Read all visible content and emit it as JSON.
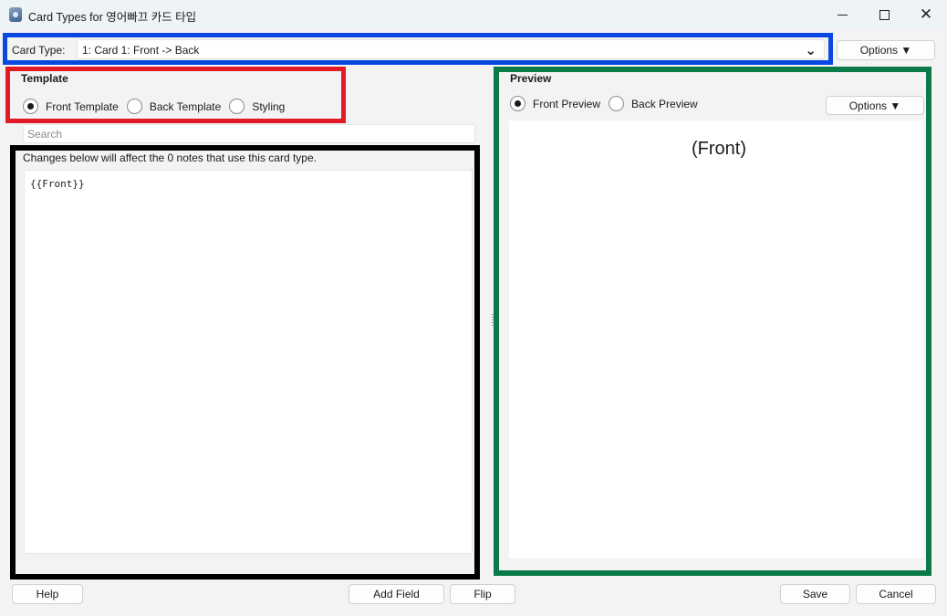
{
  "window": {
    "title": "Card Types for 영어빠끄 카드 타입",
    "icon": "anki-app-icon",
    "controls": [
      "minimize-icon",
      "maximize-icon",
      "close-icon"
    ]
  },
  "card_type": {
    "label": "Card Type:",
    "selected": "1: Card 1: Front -> Back",
    "options_button": "Options ▼"
  },
  "template": {
    "heading": "Template",
    "radios": [
      {
        "label": "Front Template",
        "checked": true
      },
      {
        "label": "Back Template",
        "checked": false
      },
      {
        "label": "Styling",
        "checked": false
      }
    ],
    "search_placeholder": "Search",
    "notice": "Changes below will affect the 0 notes that use this card type.",
    "editor_content": "{{Front}}"
  },
  "preview": {
    "heading": "Preview",
    "radios": [
      {
        "label": "Front Preview",
        "checked": true
      },
      {
        "label": "Back Preview",
        "checked": false
      }
    ],
    "options_button": "Options ▼",
    "rendered_text": "(Front)"
  },
  "footer": {
    "help": "Help",
    "add_field": "Add Field",
    "flip": "Flip",
    "save": "Save",
    "cancel": "Cancel"
  },
  "annotation_colors": {
    "blue": "#0a47e1",
    "red": "#e01b24",
    "black": "#000000",
    "green": "#0a7a49"
  }
}
